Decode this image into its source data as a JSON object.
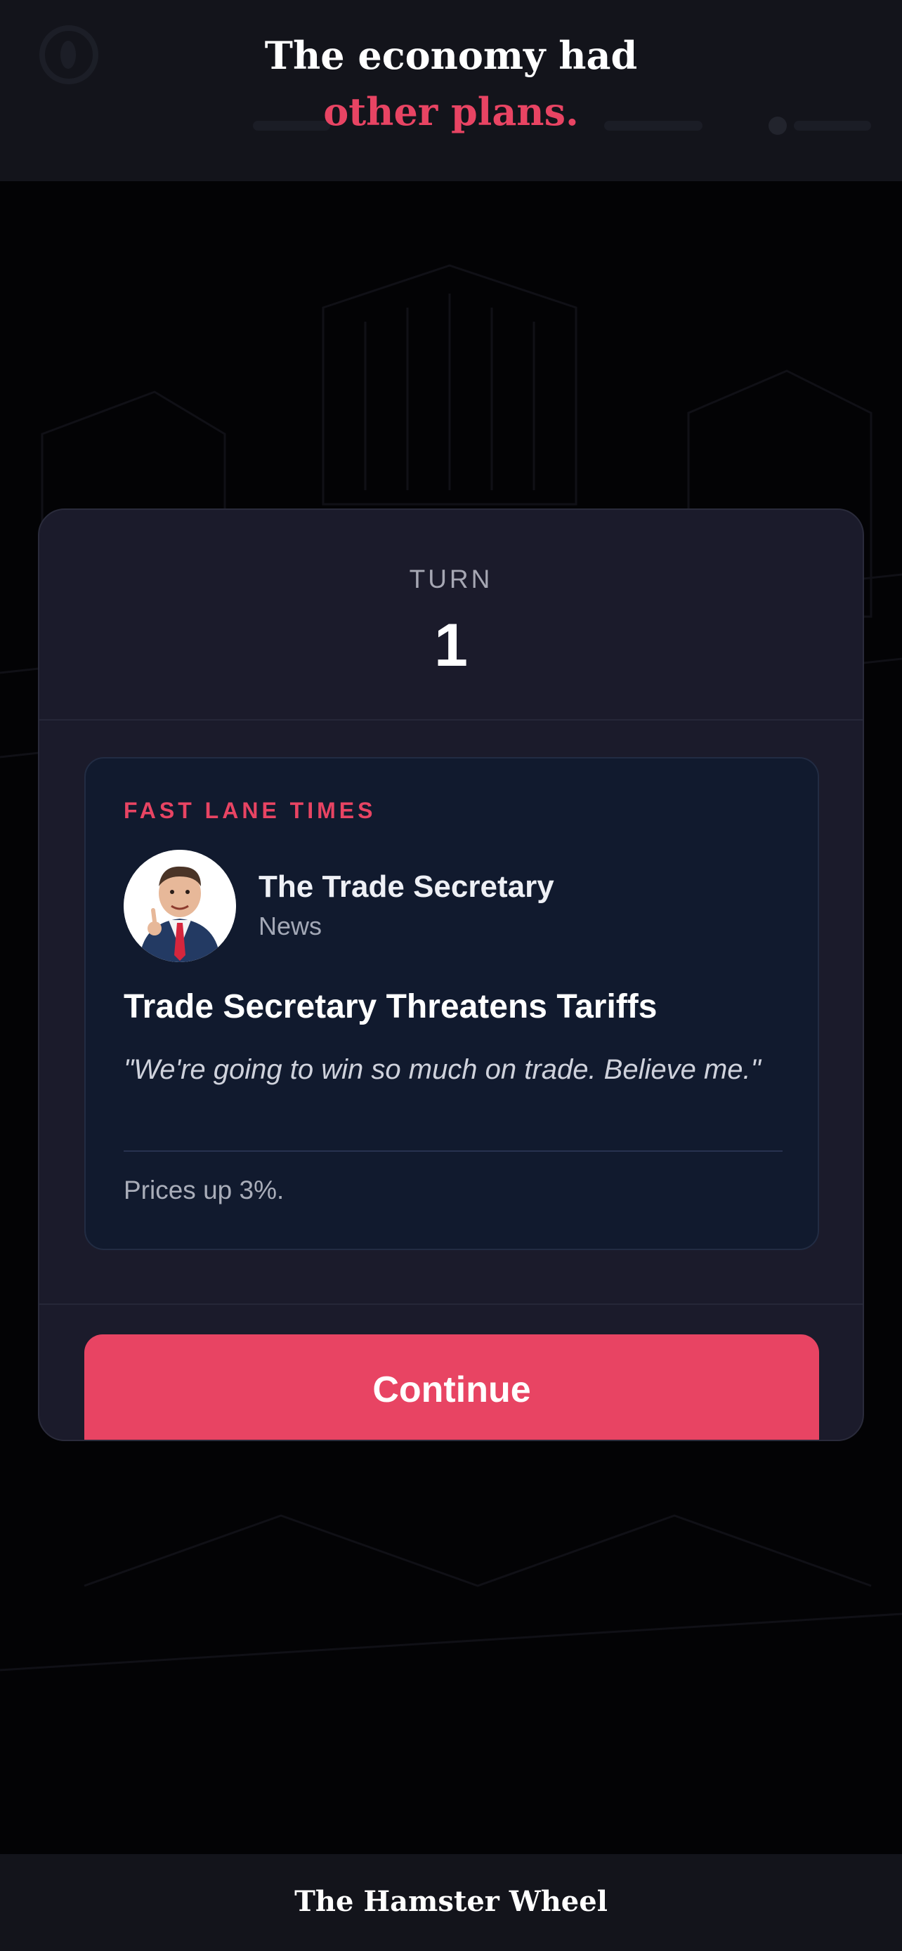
{
  "header": {
    "headline_line1": "The economy had",
    "headline_line2": "other plans.",
    "accent_color": "#e84463"
  },
  "modal": {
    "turn_label": "TURN",
    "turn_number": "1",
    "news": {
      "outlet": "FAST LANE TIMES",
      "author_name": "The Trade Secretary",
      "author_role": "News",
      "avatar": "trade-secretary-avatar-icon",
      "title": "Trade Secretary Threatens Tariffs",
      "quote": "\"We're going to win so much on trade. Believe me.\"",
      "effect": "Prices up 3%."
    },
    "continue_label": "Continue"
  },
  "footer": {
    "title": "The Hamster Wheel"
  }
}
